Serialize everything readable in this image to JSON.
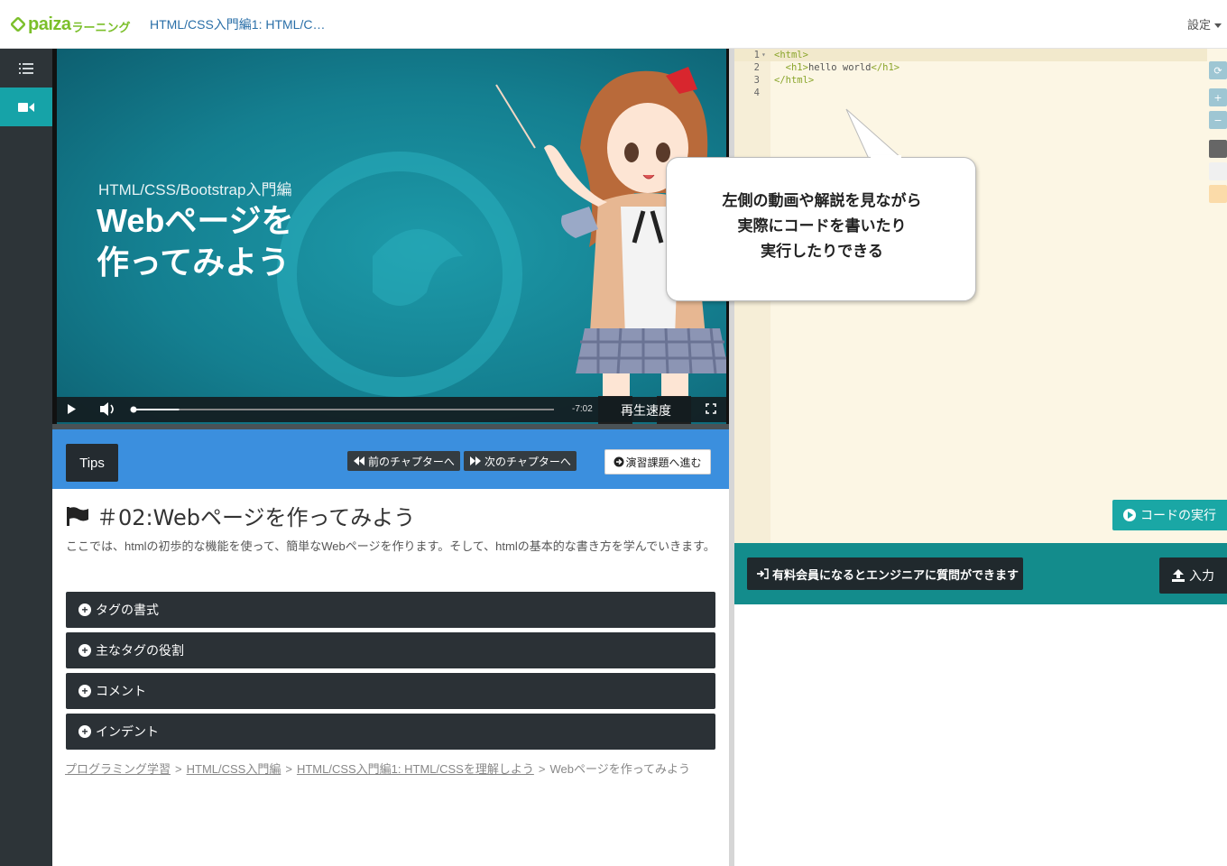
{
  "header": {
    "logo": "paiza",
    "logo_sub": "ラーニング",
    "course_title": "HTML/CSS入門編1: HTML/C…",
    "settings_label": "設定"
  },
  "video": {
    "subtitle": "HTML/CSS/Bootstrap入門編",
    "main_title": "Webページを\n作ってみよう",
    "time_remaining": "-7:02",
    "speed_label": "再生速度",
    "progress": 0.11
  },
  "tips_bar": {
    "tips_label": "Tips",
    "prev_label": "前のチャプターへ",
    "next_label": "次のチャプターへ",
    "exercise_label": "演習課題へ進む"
  },
  "lesson": {
    "title": "＃02:Webページを作ってみよう",
    "description": "ここでは、htmlの初歩的な機能を使って、簡単なWebページを作ります。そして、htmlの基本的な書き方を学んでいきます。",
    "sections": [
      "タグの書式",
      "主なタグの役割",
      "コメント",
      "インデント"
    ],
    "breadcrumb": [
      "プログラミング学習",
      "HTML/CSS入門編",
      "HTML/CSS入門編1: HTML/CSSを理解しよう",
      "Webページを作ってみよう"
    ]
  },
  "editor": {
    "line_numbers": [
      "1",
      "2",
      "3",
      "4"
    ],
    "callout_text": "左側の動画や解説を見ながら\n実際にコードを書いたり\n実行したりできる",
    "run_label": "コードの実行"
  },
  "bottom": {
    "ask_label": "有料会員になるとエンジニアに質問ができます",
    "input_label": "入力"
  }
}
